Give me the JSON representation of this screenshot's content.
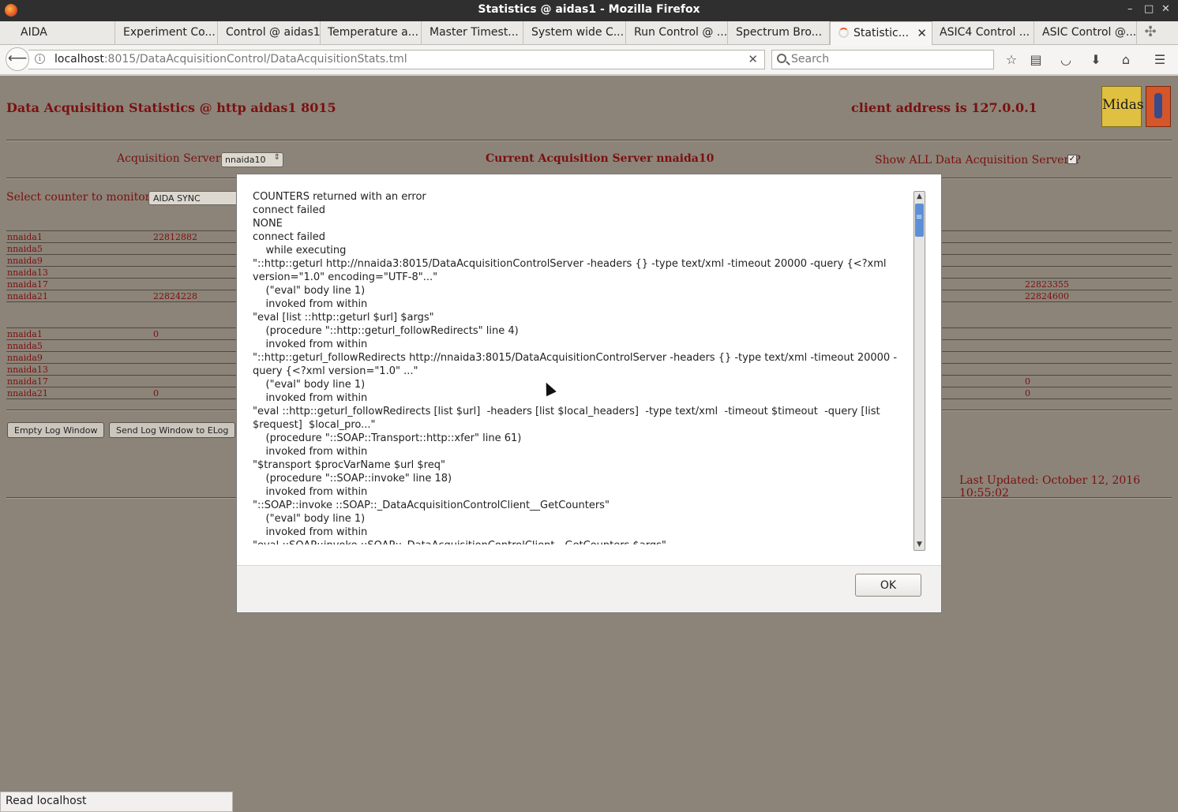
{
  "window": {
    "title": "Statistics @ aidas1 - Mozilla Firefox",
    "controls": [
      "–",
      "□",
      "✕"
    ]
  },
  "tabs": [
    {
      "label": "AIDA"
    },
    {
      "label": "Experiment Co..."
    },
    {
      "label": "Control @ aidas1"
    },
    {
      "label": "Temperature a..."
    },
    {
      "label": "Master Timest..."
    },
    {
      "label": "System wide C..."
    },
    {
      "label": "Run Control @ ..."
    },
    {
      "label": "Spectrum Bro..."
    },
    {
      "label": "Statistic...",
      "active": true
    },
    {
      "label": "ASIC4 Control ..."
    },
    {
      "label": "ASIC Control @..."
    }
  ],
  "navbar": {
    "url_host": "localhost",
    "url_rest": ":8015/DataAcquisitionControl/DataAcquisitionStats.tml",
    "search_placeholder": "Search"
  },
  "page": {
    "title": "Data Acquisition Statistics @ http aidas1 8015",
    "client_address": "client address is 127.0.0.1",
    "logo_text": "Midas",
    "acq_servers_label": "Acquisition Servers",
    "acq_server_value": "nnaida10",
    "current_server": "Current Acquisition Server nnaida10",
    "show_all_label": "Show ALL Data Acquisition Servers?",
    "show_all_checked": "✓",
    "select_counter_label": "Select counter to monitor",
    "counter_value": "AIDA SYNC",
    "table1": [
      {
        "name": "nnaida1",
        "v1": "22812882",
        "v2": ""
      },
      {
        "name": "nnaida5",
        "v1": "",
        "v2": ""
      },
      {
        "name": "nnaida9",
        "v1": "",
        "v2": ""
      },
      {
        "name": "nnaida13",
        "v1": "",
        "v2": ""
      },
      {
        "name": "nnaida17",
        "v1": "",
        "v2": "22823355"
      },
      {
        "name": "nnaida21",
        "v1": "22824228",
        "v2": "22824600"
      }
    ],
    "table2": [
      {
        "name": "nnaida1",
        "v1": "0",
        "v2": ""
      },
      {
        "name": "nnaida5",
        "v1": "",
        "v2": ""
      },
      {
        "name": "nnaida9",
        "v1": "",
        "v2": ""
      },
      {
        "name": "nnaida13",
        "v1": "",
        "v2": ""
      },
      {
        "name": "nnaida17",
        "v1": "",
        "v2": "0"
      },
      {
        "name": "nnaida21",
        "v1": "0",
        "v2": "0"
      }
    ],
    "btn_empty_log": "Empty Log Window",
    "btn_send_log": "Send Log Window to ELog",
    "last_updated": "Last Updated: October 12, 2016 10:55:02"
  },
  "dialog": {
    "lines": [
      "COUNTERS returned with an error",
      "connect failed",
      "NONE",
      "connect failed",
      "    while executing",
      "\"::http::geturl http://nnaida3:8015/DataAcquisitionControlServer -headers {} -type text/xml -timeout 20000 -query {<?xml version=\"1.0\" encoding=\"UTF-8\"...\"",
      "    (\"eval\" body line 1)",
      "    invoked from within",
      "\"eval [list ::http::geturl $url] $args\"",
      "    (procedure \"::http::geturl_followRedirects\" line 4)",
      "    invoked from within",
      "\"::http::geturl_followRedirects http://nnaida3:8015/DataAcquisitionControlServer -headers {} -type text/xml -timeout 20000 -query {<?xml version=\"1.0\" ...\"",
      "    (\"eval\" body line 1)",
      "    invoked from within",
      "\"eval ::http::geturl_followRedirects [list $url]  -headers [list $local_headers]  -type text/xml  -timeout $timeout  -query [list $request]  $local_pro...\"",
      "    (procedure \"::SOAP::Transport::http::xfer\" line 61)",
      "    invoked from within",
      "\"$transport $procVarName $url $req\"",
      "    (procedure \"::SOAP::invoke\" line 18)",
      "    invoked from within",
      "\"::SOAP::invoke ::SOAP::_DataAcquisitionControlClient__GetCounters\"",
      "    (\"eval\" body line 1)",
      "    invoked from within",
      "\"eval ::SOAP::invoke ::SOAP::_DataAcquisitionControlClient__GetCounters $args\""
    ],
    "ok_label": "OK"
  },
  "status": {
    "text": "Read localhost"
  }
}
